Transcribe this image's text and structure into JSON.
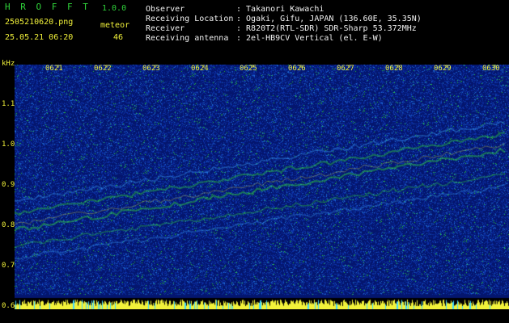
{
  "header": {
    "title": "H R O F F T",
    "version": "1.0.0",
    "filename": "2505210620.png",
    "datetime": "25.05.21 06:20",
    "meteor_label": "meteor",
    "meteor_count": "46",
    "info": [
      {
        "label": "Observer",
        "value": ": Takanori Kawachi"
      },
      {
        "label": "Receiving Location",
        "value": ": Ogaki, Gifu, JAPAN (136.60E, 35.35N)"
      },
      {
        "label": "Receiver",
        "value": ": R820T2(RTL-SDR) SDR-Sharp 53.372MHz"
      },
      {
        "label": "Receiving antenna",
        "value": ": 2el-HB9CV Vertical (el. E-W)"
      }
    ]
  },
  "y_axis": {
    "unit": "kHz",
    "ticks": [
      "1.1",
      "1.0",
      "0.9",
      "0.8",
      "0.7",
      "0.6"
    ]
  },
  "x_axis": {
    "ticks": [
      "0621",
      "0622",
      "0623",
      "0624",
      "0625",
      "0626",
      "0627",
      "0628",
      "0629",
      "0630"
    ]
  },
  "colors": {
    "background": "#000000",
    "spectrum_base": "#061a8a",
    "signal_green": "#2fd23a",
    "signal_yellow": "#f2f23a",
    "text_header": "#f0f0f0",
    "text_accent": "#f2f23a"
  }
}
